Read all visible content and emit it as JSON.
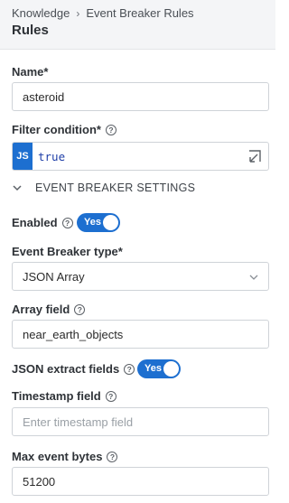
{
  "header": {
    "breadcrumb": [
      "Knowledge",
      "Event Breaker Rules"
    ],
    "title": "Rules"
  },
  "form": {
    "name": {
      "label": "Name*",
      "value": "asteroid"
    },
    "filter": {
      "label": "Filter condition*",
      "badge": "JS",
      "value": "true"
    },
    "section": {
      "label": "EVENT BREAKER SETTINGS"
    },
    "enabled": {
      "label": "Enabled",
      "toggle_label": "Yes",
      "on": true
    },
    "breaker_type": {
      "label": "Event Breaker type*",
      "value": "JSON Array"
    },
    "array_field": {
      "label": "Array field",
      "value": "near_earth_objects"
    },
    "json_extract": {
      "label": "JSON extract fields",
      "toggle_label": "Yes",
      "on": true
    },
    "timestamp_field": {
      "label": "Timestamp field",
      "placeholder": "Enter timestamp field"
    },
    "max_event_bytes": {
      "label": "Max event bytes",
      "value": "51200"
    }
  },
  "colors": {
    "accent": "#1d6fd0",
    "code_text": "#1f3fa8"
  },
  "icons": [
    "chevron-right-icon",
    "help-icon",
    "expand-icon",
    "chevron-down-icon"
  ]
}
